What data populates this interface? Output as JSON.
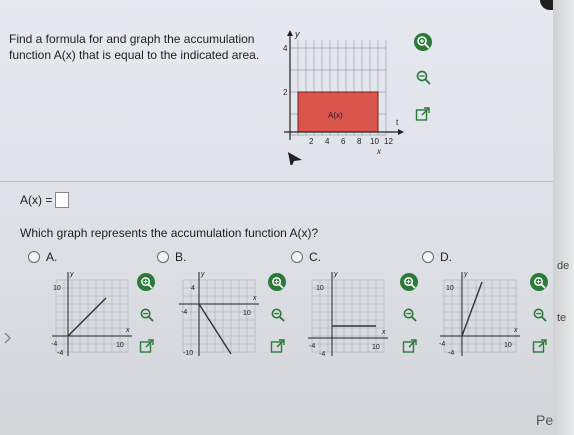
{
  "prompt": {
    "text": "Find a formula for and graph the accumulation function A(x) that is equal to the indicated area."
  },
  "main_graph": {
    "y_axis_label": "y",
    "y_ticks": [
      "4",
      "2"
    ],
    "x_ticks": [
      "2",
      "4",
      "6",
      "8",
      "10",
      "12"
    ],
    "region_label": "A(x)",
    "t_label": "t",
    "x_label": "x",
    "shade_color": "#d9544b"
  },
  "answer": {
    "label": "A(x) ="
  },
  "question": "Which graph represents the accumulation function A(x)?",
  "options": [
    {
      "letter": "A.",
      "y_label": "y",
      "x_label": "x",
      "y_top": "10",
      "y_bottom": "-4",
      "x_left": "-4",
      "x_right": "10"
    },
    {
      "letter": "B.",
      "y_label": "y",
      "x_label": "x",
      "y_top": "4",
      "y_bottom": "-10",
      "x_left": "-4",
      "x_right": "10"
    },
    {
      "letter": "C.",
      "y_label": "y",
      "x_label": "x",
      "y_top": "10",
      "y_bottom": "-4",
      "x_left": "-4",
      "x_right": "10"
    },
    {
      "letter": "D.",
      "y_label": "y",
      "x_label": "x",
      "y_top": "10",
      "y_bottom": "-4",
      "x_left": "-4",
      "x_right": "10"
    }
  ],
  "edge_fragments": [
    "de",
    "te",
    "Pe"
  ],
  "colors": {
    "zoom_in_fill": "#2b7a3a",
    "zoom_out_stroke": "#2b7a3a",
    "grid": "#9aa0a8",
    "graph_line": "#333333"
  }
}
